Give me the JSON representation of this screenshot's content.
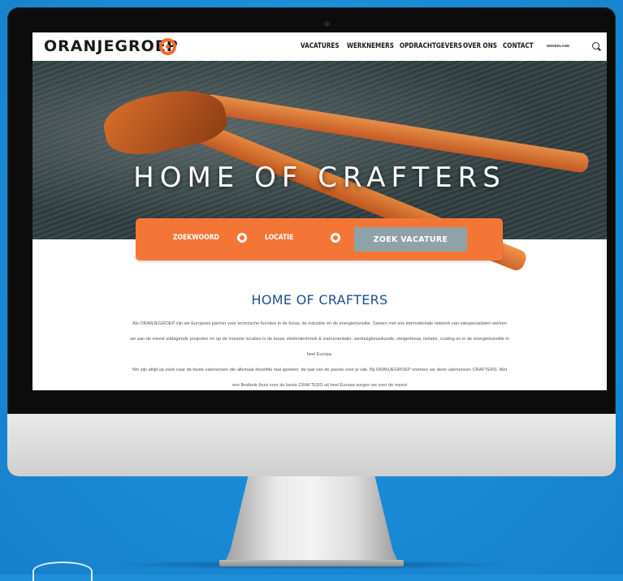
{
  "site": {
    "logo_text": "ORANJEGROEP",
    "nav": [
      {
        "label": "VACATURES"
      },
      {
        "label": "WERKNEMERS"
      },
      {
        "label": "OPDRACHTGEVERS"
      },
      {
        "label": "OVER ONS"
      },
      {
        "label": "CONTACT"
      }
    ],
    "language": "NEDERLAND",
    "search_icon": "search-icon"
  },
  "hero": {
    "title": "HOME OF CRAFTERS"
  },
  "search_bar": {
    "keyword_label": "ZOEKWOORD",
    "location_label": "LOCATIE",
    "button_label": "ZOEK VACATURE"
  },
  "content": {
    "title": "HOME OF CRAFTERS",
    "paragraph1": "Als ORANJEGROEP zijn we Europees partner voor technische functies in de bouw, de industrie en de energietransitie. Samen met ons internationale netwerk van vakspecialisten werken we aan de meest uitdagende projecten en op de mooiste locaties in de bouw, elektrotechniek & instrumentatie, werktuigbouwkunde, steigerbouw, isolatie, coating en in de energietransitie in heel Europa.",
    "paragraph2": "We zijn altijd op zoek naar de beste vakmensen die allemaal dezelfde taal spreken: de taal van de passie voor je vak. Bij ORANJEGROEP noemen we deze vakmensen CRAFTERS. Met ons flexibele thuis voor de beste CRAFTERS uit heel Europa zorgen we voor de meest"
  },
  "colors": {
    "brand_orange": "#f47636",
    "title_blue": "#1e4f8f",
    "button_grey": "#8fa2a8",
    "background_blue": "#1e8fd8"
  }
}
